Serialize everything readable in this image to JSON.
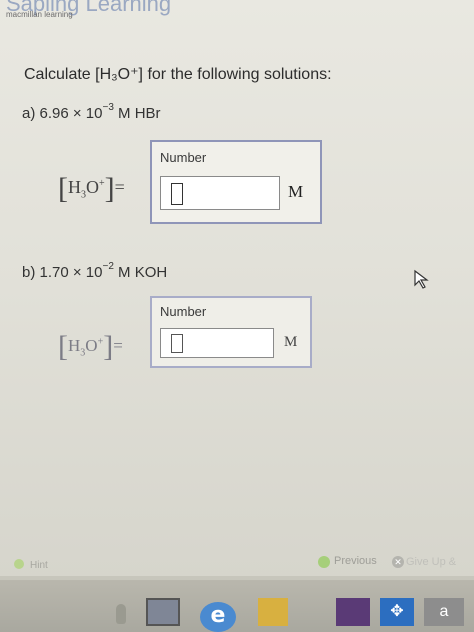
{
  "brand": {
    "name": "Sapling Learning",
    "sub": "macmillan learning"
  },
  "question": {
    "text": "Calculate [H₃O⁺] for the following solutions:"
  },
  "parts": [
    {
      "label_prefix": "a) 6.96 × 10",
      "exponent": "−3",
      "label_suffix": " M HBr",
      "box_title": "Number",
      "value": "",
      "unit": "M"
    },
    {
      "label_prefix": "b) 1.70 × 10",
      "exponent": "−2",
      "label_suffix": " M KOH",
      "box_title": "Number",
      "value": "",
      "unit": "M"
    }
  ],
  "formula": {
    "h": "H",
    "sub3": "3",
    "o": "O",
    "plus": "+",
    "equals": "="
  },
  "footer": {
    "hint": "Hint",
    "previous": "Previous",
    "give_up": "Give Up &"
  },
  "taskbar": {
    "ie_glyph": "e",
    "a_label": "a"
  },
  "colors": {
    "box_border": "#8f95b8",
    "page_bg": "#e9e8e1"
  }
}
